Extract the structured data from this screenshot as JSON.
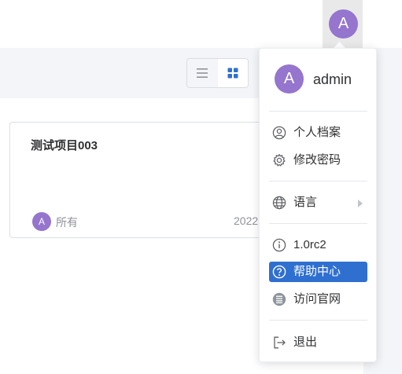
{
  "header": {
    "user_initial": "A"
  },
  "view_toggle": {
    "list_icon": "list-icon",
    "grid_icon": "grid-icon"
  },
  "project_card": {
    "title": "测试项目003",
    "owner_initial": "A",
    "owner_label": "所有",
    "date": "2022"
  },
  "dropdown": {
    "user_initial": "A",
    "username": "admin",
    "items": {
      "profile": "个人档案",
      "change_password": "修改密码",
      "language": "语言",
      "version": "1.0rc2",
      "help_center": "帮助中心",
      "website": "访问官网",
      "logout": "退出"
    },
    "active_item": "help_center"
  },
  "colors": {
    "avatar": "#9575cd",
    "accent": "#2f6fd0",
    "page_bg": "#f4f5f8"
  }
}
